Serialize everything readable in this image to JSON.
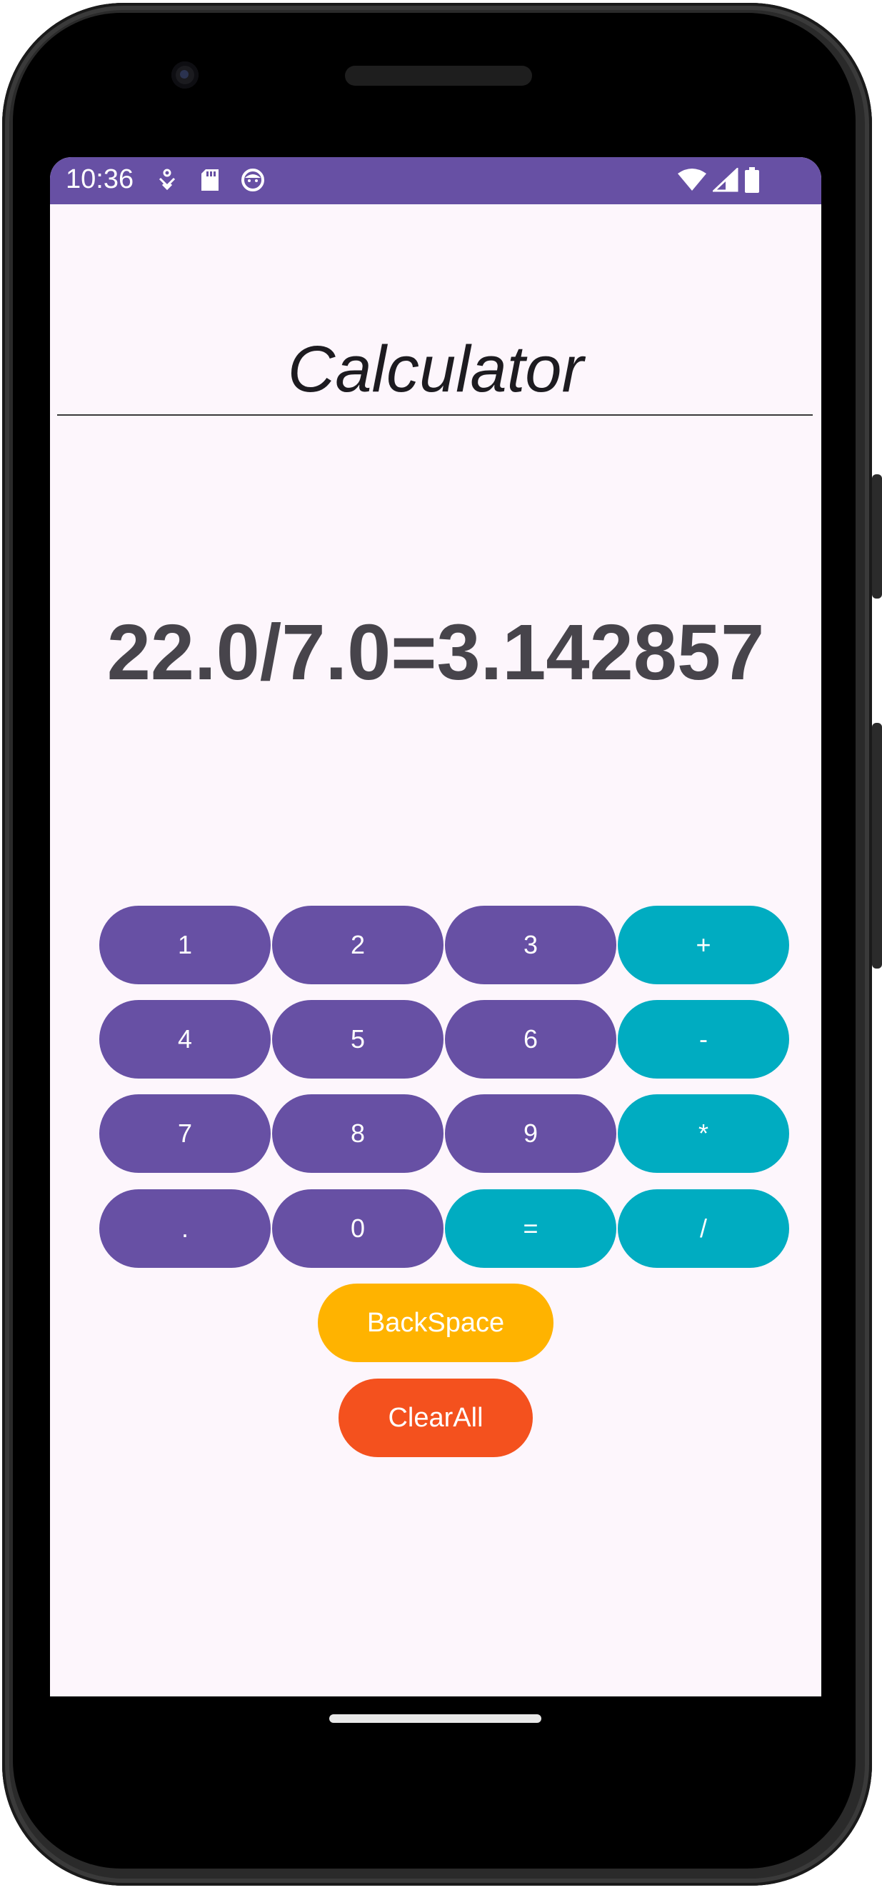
{
  "status_bar": {
    "time": "10:36",
    "color": "#6750a4",
    "left_icons": [
      "location-accessibility-icon",
      "sd-card-icon",
      "face-icon"
    ],
    "right_icons": [
      "wifi-icon",
      "signal-icon",
      "battery-icon"
    ]
  },
  "app": {
    "title": "Calculator",
    "display": "22.0/7.0=3.142857"
  },
  "keypad": {
    "k1": "1",
    "k2": "2",
    "k3": "3",
    "plus": "+",
    "k4": "4",
    "k5": "5",
    "k6": "6",
    "minus": "-",
    "k7": "7",
    "k8": "8",
    "k9": "9",
    "multiply": "*",
    "dot": ".",
    "k0": "0",
    "equals": "=",
    "divide": "/",
    "backspace": "BackSpace",
    "clear_all": "ClearAll"
  },
  "colors": {
    "digit_key": "#6750a4",
    "operator_key": "#00acc1",
    "backspace_key": "#ffb300",
    "clear_key": "#f4511e",
    "screen_background": "#fdf6fc"
  }
}
